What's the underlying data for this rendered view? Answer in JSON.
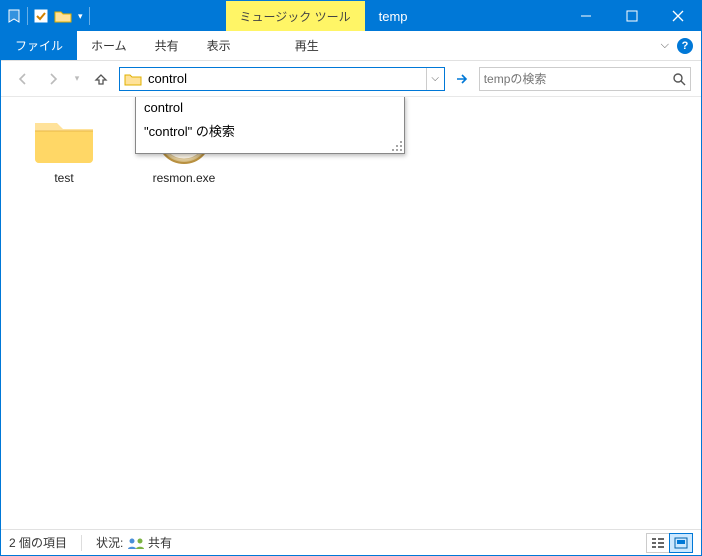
{
  "titlebar": {
    "context_tab_label": "ミュージック ツール",
    "title": "temp"
  },
  "ribbon": {
    "file_tab": "ファイル",
    "tabs": [
      "ホーム",
      "共有",
      "表示"
    ],
    "context_tab": "再生"
  },
  "nav": {
    "address_value": "control",
    "search_placeholder": "tempの検索"
  },
  "suggestions": {
    "items": [
      "control",
      "\"control\" の検索"
    ]
  },
  "content": {
    "items": [
      {
        "name": "test",
        "kind": "folder"
      },
      {
        "name": "resmon.exe",
        "kind": "resmon_exe"
      }
    ]
  },
  "status": {
    "item_count_text": "2 個の項目",
    "state_label": "状況:",
    "state_value": "共有"
  },
  "colors": {
    "accent": "#0078d7",
    "context_highlight": "#fff566"
  }
}
